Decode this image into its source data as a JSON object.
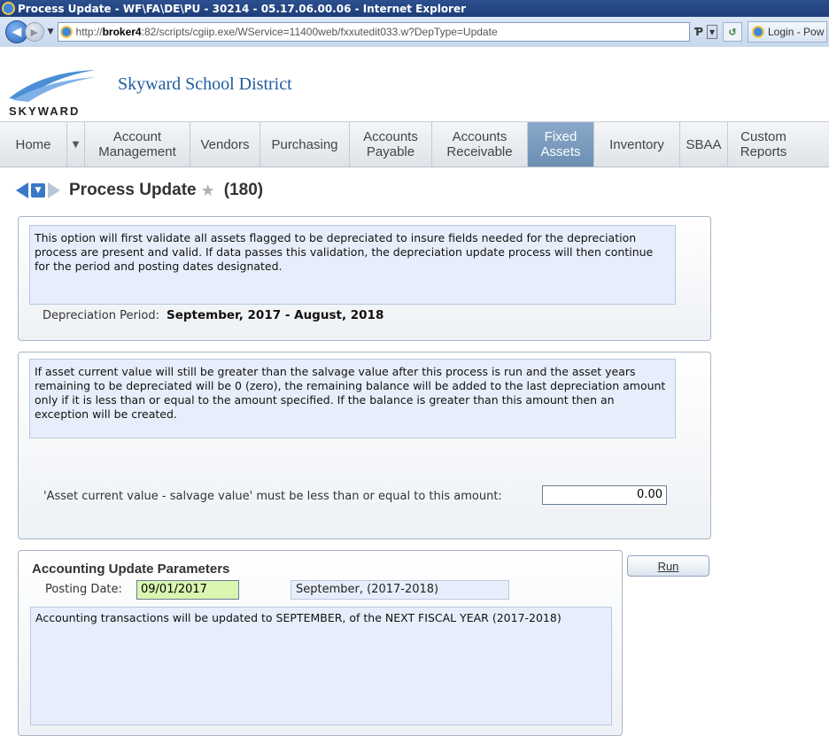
{
  "window": {
    "title": "Process Update - WF\\FA\\DE\\PU - 30214 - 05.17.06.00.06 - Internet Explorer"
  },
  "address_bar": {
    "url_prefix": "http://",
    "url_host": "broker4",
    "url_rest": ":82/scripts/cgiip.exe/WService=11400web/fxxutedit033.w?DepType=Update",
    "search_symbol": "Ƥ",
    "dropdown_symbol": "▾",
    "refresh_symbol": "↺",
    "tab_label": "Login - Pow"
  },
  "brand": {
    "district": "Skyward School District",
    "logo_text": "SKYWARD"
  },
  "menu": [
    {
      "label": "Home",
      "active": false
    },
    {
      "label": "Account Management",
      "active": false
    },
    {
      "label": "Vendors",
      "active": false
    },
    {
      "label": "Purchasing",
      "active": false
    },
    {
      "label": "Accounts Payable",
      "active": false
    },
    {
      "label": "Accounts Receivable",
      "active": false
    },
    {
      "label": "Fixed Assets",
      "active": true
    },
    {
      "label": "Inventory",
      "active": false
    },
    {
      "label": "SBAA",
      "active": false
    },
    {
      "label": "Custom Reports",
      "active": false
    }
  ],
  "page": {
    "title": "Process Update",
    "count": "(180)"
  },
  "depreciation": {
    "info": "This option will first validate all assets flagged to be depreciated to insure fields needed for the depreciation process are present and valid.  If data passes this validation, the depreciation update process will then continue for the period and posting dates designated.",
    "period_label": "Depreciation Period:",
    "period_value": "September, 2017 - August, 2018"
  },
  "salvage": {
    "info": "If asset current value will still be greater than the salvage value after this process is run and the asset years remaining to be depreciated will be 0 (zero), the remaining balance will be added to the last depreciation amount only if it is less than or equal to the amount specified.  If the balance is greater than this amount then an exception will be created.",
    "amount_label": "'Asset current value - salvage value' must be less than or equal to this amount:",
    "amount_value": "0.00"
  },
  "accounting": {
    "heading": "Accounting Update Parameters",
    "posting_date_label": "Posting Date:",
    "posting_date_value": "09/01/2017",
    "period_display": "September, (2017-2018)",
    "message": "Accounting transactions will be updated to SEPTEMBER, of the NEXT FISCAL YEAR (2017-2018)"
  },
  "run_button": {
    "label": "Run"
  }
}
